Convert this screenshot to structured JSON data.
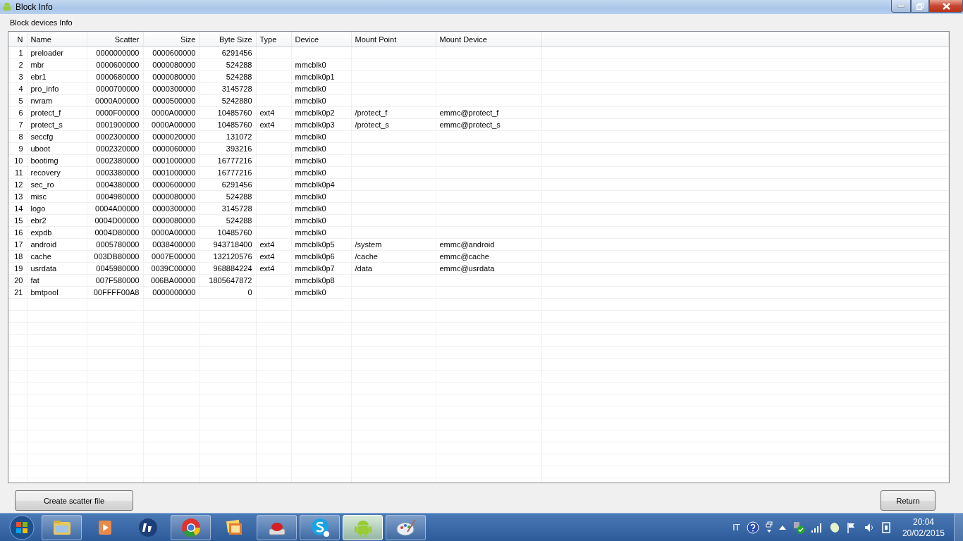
{
  "window": {
    "title": "Block Info"
  },
  "group": {
    "title": "Block devices Info"
  },
  "table": {
    "columns": [
      "N",
      "Name",
      "Scatter",
      "Size",
      "Byte Size",
      "Type",
      "Device",
      "Mount Point",
      "Mount Device"
    ],
    "rows": [
      [
        "1",
        "preloader",
        "0000000000",
        "0000600000",
        "6291456",
        null,
        null,
        null,
        null
      ],
      [
        "2",
        "mbr",
        "0000600000",
        "0000080000",
        "524288",
        null,
        "mmcblk0",
        null,
        null
      ],
      [
        "3",
        "ebr1",
        "0000680000",
        "0000080000",
        "524288",
        null,
        "mmcblk0p1",
        null,
        null
      ],
      [
        "4",
        "pro_info",
        "0000700000",
        "0000300000",
        "3145728",
        null,
        "mmcblk0",
        null,
        null
      ],
      [
        "5",
        "nvram",
        "0000A00000",
        "0000500000",
        "5242880",
        null,
        "mmcblk0",
        null,
        null
      ],
      [
        "6",
        "protect_f",
        "0000F00000",
        "0000A00000",
        "10485760",
        "ext4",
        "mmcblk0p2",
        "/protect_f",
        "emmc@protect_f"
      ],
      [
        "7",
        "protect_s",
        "0001900000",
        "0000A00000",
        "10485760",
        "ext4",
        "mmcblk0p3",
        "/protect_s",
        "emmc@protect_s"
      ],
      [
        "8",
        "seccfg",
        "0002300000",
        "0000020000",
        "131072",
        null,
        "mmcblk0",
        null,
        null
      ],
      [
        "9",
        "uboot",
        "0002320000",
        "0000060000",
        "393216",
        null,
        "mmcblk0",
        null,
        null
      ],
      [
        "10",
        "bootimg",
        "0002380000",
        "0001000000",
        "16777216",
        null,
        "mmcblk0",
        null,
        null
      ],
      [
        "11",
        "recovery",
        "0003380000",
        "0001000000",
        "16777216",
        null,
        "mmcblk0",
        null,
        null
      ],
      [
        "12",
        "sec_ro",
        "0004380000",
        "0000600000",
        "6291456",
        null,
        "mmcblk0p4",
        null,
        null
      ],
      [
        "13",
        "misc",
        "0004980000",
        "0000080000",
        "524288",
        null,
        "mmcblk0",
        null,
        null
      ],
      [
        "14",
        "logo",
        "0004A00000",
        "0000300000",
        "3145728",
        null,
        "mmcblk0",
        null,
        null
      ],
      [
        "15",
        "ebr2",
        "0004D00000",
        "0000080000",
        "524288",
        null,
        "mmcblk0",
        null,
        null
      ],
      [
        "16",
        "expdb",
        "0004D80000",
        "0000A00000",
        "10485760",
        null,
        "mmcblk0",
        null,
        null
      ],
      [
        "17",
        "android",
        "0005780000",
        "0038400000",
        "943718400",
        "ext4",
        "mmcblk0p5",
        "/system",
        "emmc@android"
      ],
      [
        "18",
        "cache",
        "003DB80000",
        "0007E00000",
        "132120576",
        "ext4",
        "mmcblk0p6",
        "/cache",
        "emmc@cache"
      ],
      [
        "19",
        "usrdata",
        "0045980000",
        "0039C00000",
        "968884224",
        "ext4",
        "mmcblk0p7",
        "/data",
        "emmc@usrdata"
      ],
      [
        "20",
        "fat",
        "007F580000",
        "006BA00000",
        "1805647872",
        null,
        "mmcblk0p8",
        null,
        null
      ],
      [
        "21",
        "bmtpool",
        "00FFFF00A8",
        "0000000000",
        "0",
        null,
        "mmcblk0",
        null,
        null
      ]
    ]
  },
  "buttons": {
    "create": "Create scatter file",
    "return": "Return"
  },
  "taskbar": {
    "items": [
      {
        "kind": "folder",
        "running": true,
        "selected": false
      },
      {
        "kind": "media",
        "running": false,
        "selected": false
      },
      {
        "kind": "hp",
        "running": false,
        "selected": false
      },
      {
        "kind": "chrome",
        "running": true,
        "selected": false
      },
      {
        "kind": "photos",
        "running": false,
        "selected": false
      },
      {
        "kind": "pushbutton",
        "running": true,
        "selected": false
      },
      {
        "kind": "skype",
        "running": true,
        "selected": false
      },
      {
        "kind": "android",
        "running": true,
        "selected": true
      },
      {
        "kind": "paint",
        "running": true,
        "selected": false
      }
    ],
    "language": "IT",
    "time": "20:04",
    "date": "20/02/2015"
  }
}
